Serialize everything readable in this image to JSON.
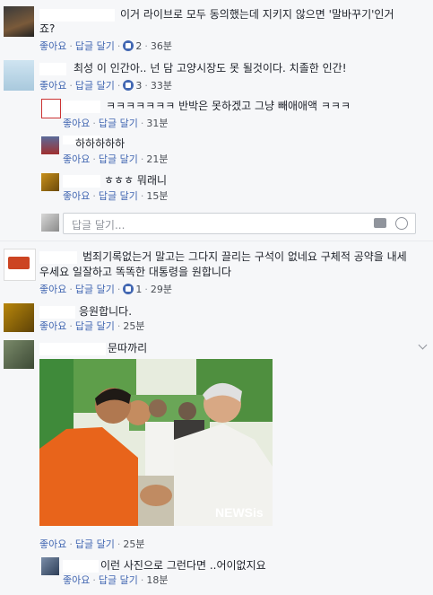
{
  "comments": [
    {
      "text": "이거 라이브로 모두 동의했는데 지키지 않으면 '말바꾸기'인거",
      "text2": "죠?",
      "like": "좋아요",
      "reply": "답글 달기",
      "likes": "2",
      "time": "36분"
    },
    {
      "text": "최성 이 인간아.. 넌 담 고양시장도 못 될것이다. 치졸한 인간!",
      "like": "좋아요",
      "reply": "답글 달기",
      "likes": "3",
      "time": "33분"
    }
  ],
  "replies": [
    {
      "text": "ㅋㅋㅋㅋㅋㅋㅋ 반박은 못하겠고 그냥 빼애애액 ㅋㅋㅋ",
      "like": "좋아요",
      "reply": "답글 달기",
      "time": "31분"
    },
    {
      "text": "하하하하하",
      "like": "좋아요",
      "reply": "답글 달기",
      "time": "21분"
    },
    {
      "text": "ㅎㅎㅎ 뭐래니",
      "like": "좋아요",
      "reply": "답글 달기",
      "time": "15분"
    }
  ],
  "reply_input": {
    "placeholder": "답글 달기..."
  },
  "comments2": [
    {
      "text": "범죄기록없는거 말고는 그다지 끌리는 구석이 없네요 구체적 공약을 내세",
      "text2": "우세요 일잘하고 똑똑한 대통령을 원합니다",
      "like": "좋아요",
      "reply": "답글 달기",
      "likes": "1",
      "time": "29분"
    },
    {
      "text": "응원합니다.",
      "like": "좋아요",
      "reply": "답글 달기",
      "time": "25분"
    },
    {
      "text": "문따까리",
      "like": "좋아요",
      "reply": "답글 달기",
      "time": "25분",
      "watermark": "NEWSis"
    }
  ],
  "last_reply": {
    "text": "이런 사진으로 그런다면 ..어이없지요",
    "like": "좋아요",
    "reply": "답글 달기",
    "time": "18분"
  },
  "colors": {
    "link": "#4267b2",
    "meta": "#90949c",
    "background": "#f6f7f9"
  }
}
